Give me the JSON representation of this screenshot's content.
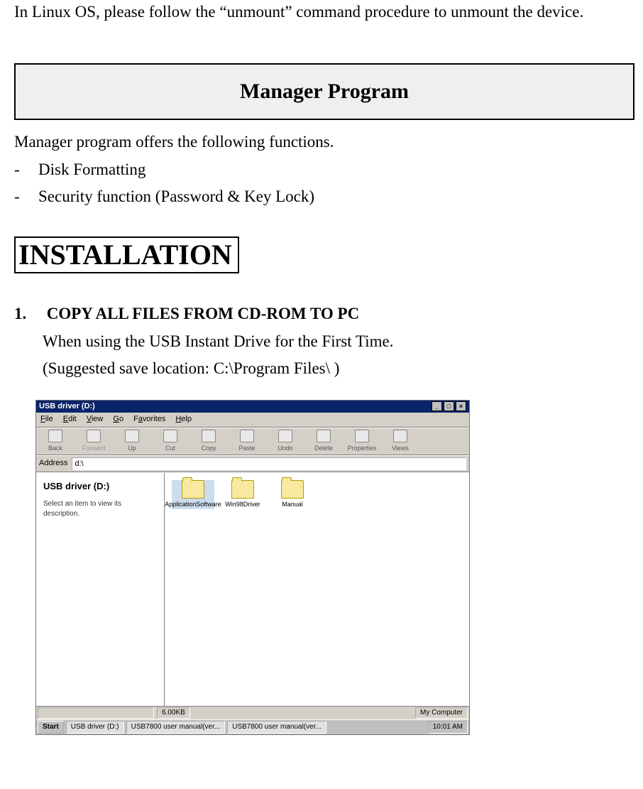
{
  "lead": "In Linux OS, please follow the “unmount” command procedure to unmount the device.",
  "section_title": "Manager Program",
  "intro": "Manager program offers the following functions.",
  "functions": [
    "Disk Formatting",
    "Security function (Password & Key Lock)"
  ],
  "installation_heading": "INSTALLATION",
  "step1": {
    "number": "1.",
    "title": "COPY ALL FILES FROM CD-ROM TO PC",
    "line1": "When using the USB Instant Drive for the First Time.",
    "line2": "(Suggested save location: C:\\Program Files\\ )"
  },
  "screenshot": {
    "window_title": "USB driver (D:)",
    "menu": {
      "file": "File",
      "edit": "Edit",
      "view": "View",
      "go": "Go",
      "fav": "Favorites",
      "help": "Help"
    },
    "toolbar": {
      "back": "Back",
      "forward": "Forward",
      "up": "Up",
      "cut": "Cut",
      "copy": "Copy",
      "paste": "Paste",
      "undo": "Undo",
      "delete": "Delete",
      "properties": "Properties",
      "views": "Views"
    },
    "address_label": "Address",
    "address_value": "d:\\",
    "left_pane": {
      "title": "USB driver (D:)",
      "hint": "Select an item to view its description."
    },
    "folders": [
      {
        "name": "ApplicationSoftware"
      },
      {
        "name": "Win98Driver"
      },
      {
        "name": "Manual"
      }
    ],
    "status": {
      "size": "6.00KB",
      "location": "My Computer"
    },
    "taskbar": {
      "start": "Start",
      "tasks": [
        "USB driver (D:)",
        "USB7800 user manual(ver...",
        "USB7800 user manual(ver..."
      ],
      "clock": "10:01 AM"
    }
  }
}
